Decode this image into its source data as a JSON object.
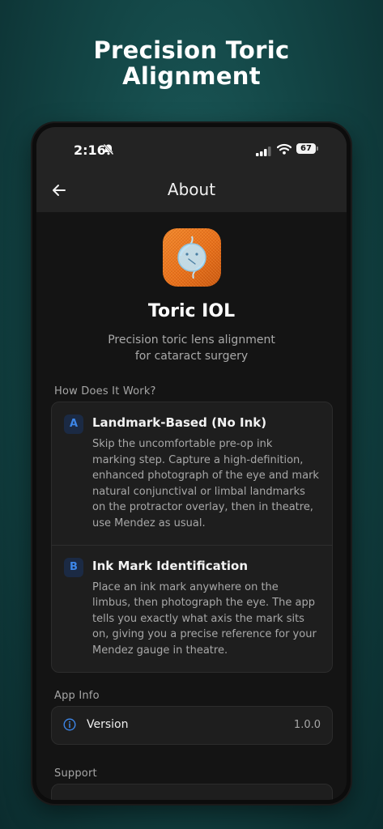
{
  "promo": {
    "title": "Precision Toric\nAlignment"
  },
  "status_bar": {
    "time": "2:16",
    "battery": "67"
  },
  "app_bar": {
    "title": "About"
  },
  "app": {
    "name": "Toric IOL",
    "tagline": "Precision toric lens alignment\nfor cataract surgery"
  },
  "how_it_works": {
    "header": "How Does It Work?",
    "methods": [
      {
        "badge": "A",
        "title": "Landmark-Based (No Ink)",
        "description": "Skip the uncomfortable pre-op ink marking step. Capture a high-definition, enhanced photograph of the eye and mark natural conjunctival or limbal landmarks on the protractor overlay, then in theatre, use Mendez as usual."
      },
      {
        "badge": "B",
        "title": "Ink Mark Identification",
        "description": "Place an ink mark anywhere on the limbus, then photograph the eye. The app tells you exactly what axis the mark sits on, giving you a precise reference for your Mendez gauge in theatre."
      }
    ]
  },
  "app_info": {
    "header": "App Info",
    "version_label": "Version",
    "version_value": "1.0.0"
  },
  "support": {
    "header": "Support"
  },
  "colors": {
    "accent": "#3d86e8",
    "icon_orange": "#e8701b",
    "card_bg": "#1e1e1e",
    "screen_bg": "#141414"
  }
}
